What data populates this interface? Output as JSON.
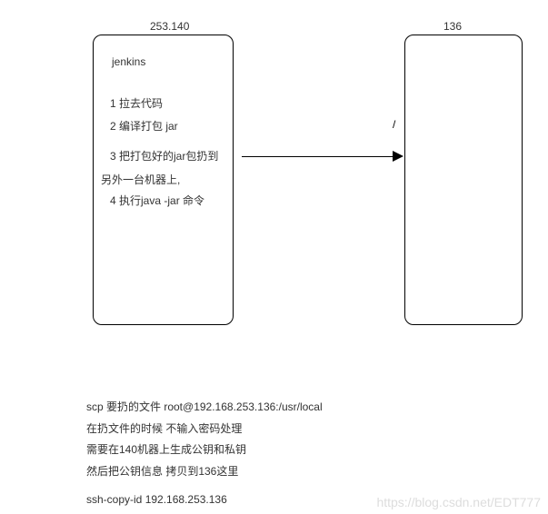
{
  "labels": {
    "left": "253.140",
    "right": "136"
  },
  "leftBox": {
    "title": "jenkins",
    "step1": "1 拉去代码",
    "step2": "2 编译打包 jar",
    "step3a": "3  把打包好的jar包扔到",
    "step3b": "另外一台机器上,",
    "step4": "4 执行java -jar 命令"
  },
  "arrowMark": "/",
  "notes": {
    "line1": "scp  要扔的文件  root@192.168.253.136:/usr/local",
    "line2": "在扔文件的时候 不输入密码处理",
    "line3": "需要在140机器上生成公钥和私钥",
    "line4": "然后把公钥信息  拷贝到136这里",
    "line5": "ssh-copy-id    192.168.253.136"
  },
  "watermark": "https://blog.csdn.net/EDT777"
}
